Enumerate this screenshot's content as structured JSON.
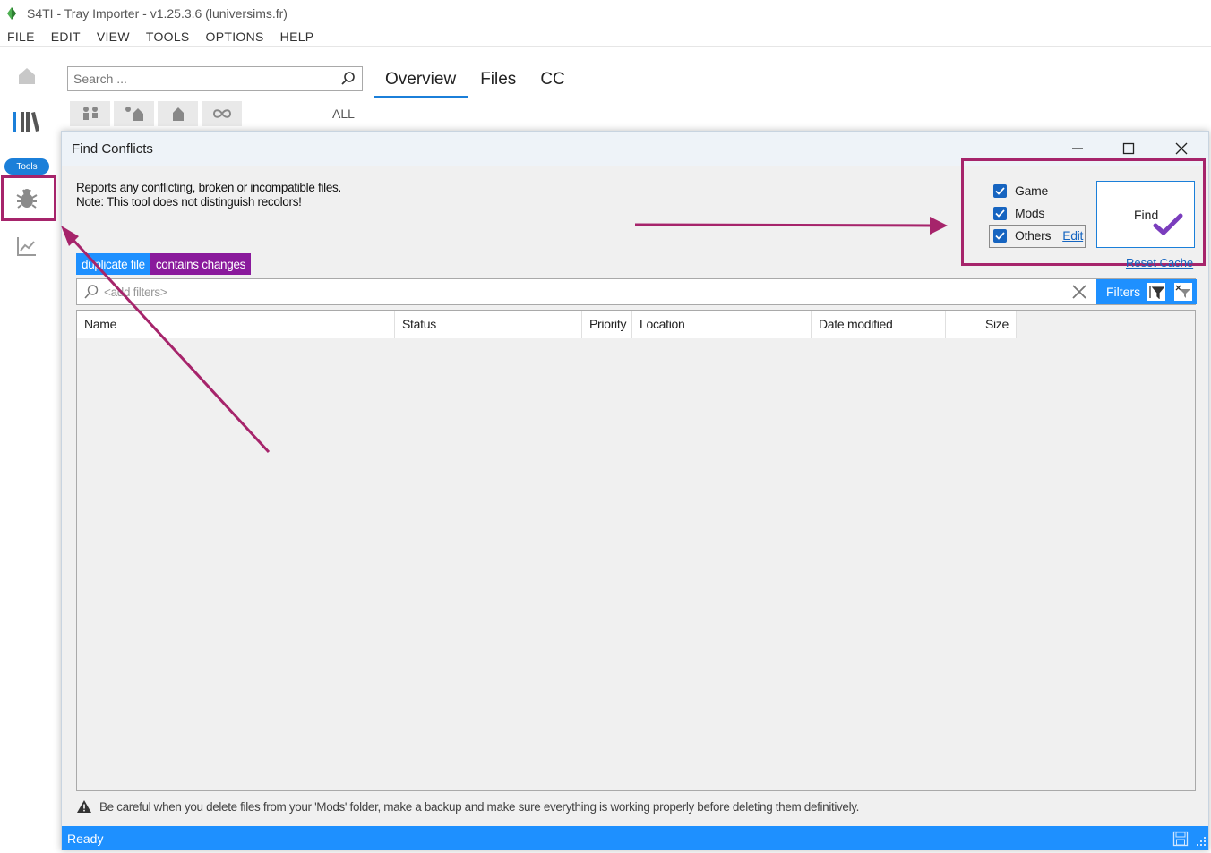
{
  "window": {
    "title": "S4TI - Tray Importer - v1.25.3.6  (luniversims.fr)"
  },
  "menu": [
    "FILE",
    "EDIT",
    "VIEW",
    "TOOLS",
    "OPTIONS",
    "HELP"
  ],
  "sidebar": {
    "tools_label": "Tools",
    "icons": [
      "home-icon",
      "library-icon",
      "bug-icon",
      "chart-icon"
    ]
  },
  "search": {
    "placeholder": "Search ..."
  },
  "tabs": [
    {
      "label": "Overview",
      "active": true
    },
    {
      "label": "Files",
      "active": false
    },
    {
      "label": "CC",
      "active": false
    }
  ],
  "filters": {
    "icons": [
      "households-icon",
      "lots-icon",
      "rooms-icon",
      "infinity-icon"
    ],
    "all_label": "ALL"
  },
  "dialog": {
    "title": "Find Conflicts",
    "description_line1": "Reports any conflicting, broken or incompatible files.",
    "description_line2": "Note: This tool does not distinguish recolors!",
    "options": [
      {
        "label": "Game",
        "checked": true
      },
      {
        "label": "Mods",
        "checked": true
      },
      {
        "label": "Others",
        "checked": true
      }
    ],
    "edit_link": "Edit",
    "find_button": "Find",
    "reset_cache": "Reset Cache",
    "legend": {
      "duplicate": "duplicate file",
      "changes": "contains changes"
    },
    "filter_placeholder": "<add filters>",
    "filters_button": "Filters",
    "columns": [
      "Name",
      "Status",
      "Priority",
      "Location",
      "Date modified",
      "Size"
    ],
    "warning": "Be careful when you delete files from your 'Mods' folder, make a backup and make sure everything is working properly before deleting them definitively.",
    "status": "Ready"
  },
  "colors": {
    "accent": "#1e90ff",
    "annotation": "#a6246b",
    "changes_purple": "#8a1a9c",
    "checkbox": "#1664c0"
  }
}
